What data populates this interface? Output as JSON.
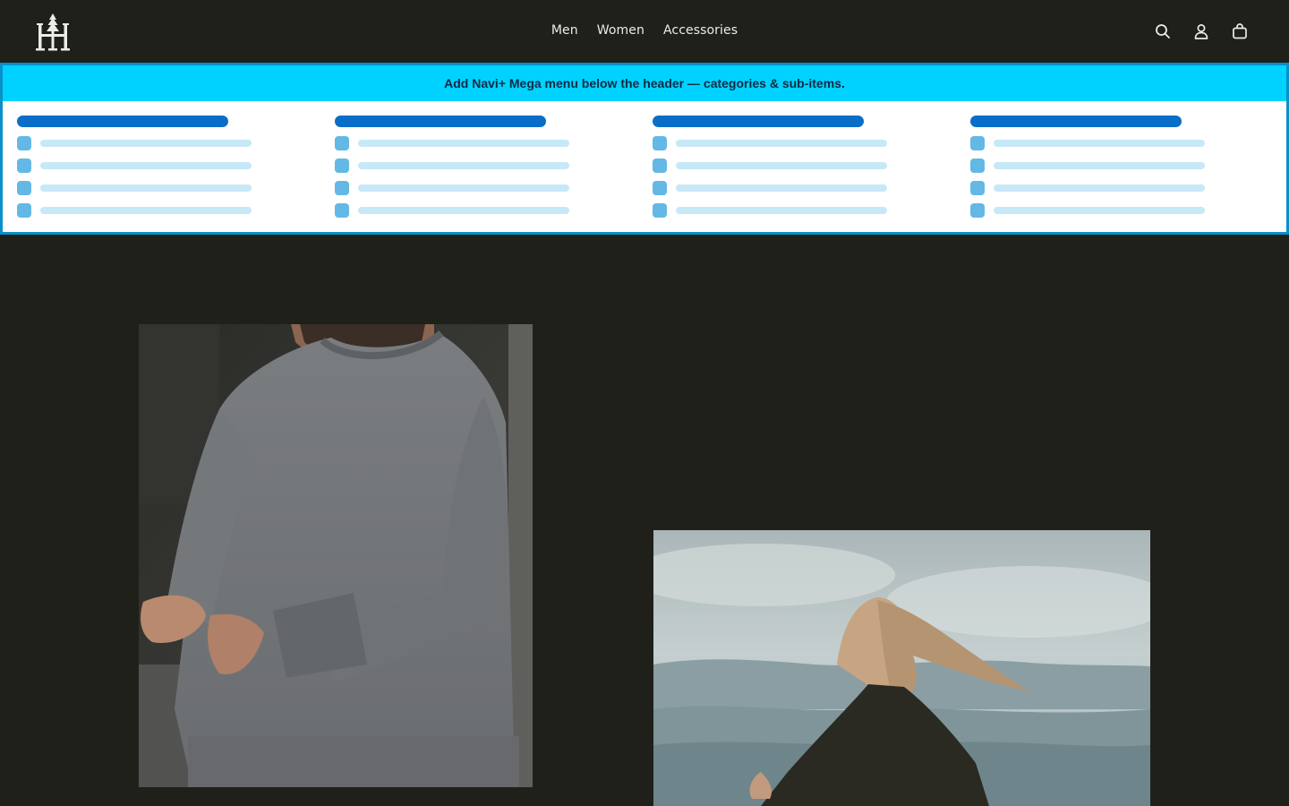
{
  "brand": {
    "logo_icon": "tree-monogram-logo",
    "logo_color": "#ecebe6"
  },
  "nav": {
    "items": [
      {
        "label": "Men"
      },
      {
        "label": "Women"
      },
      {
        "label": "Accessories"
      }
    ]
  },
  "header_icons": {
    "search": "search-icon",
    "account": "account-icon",
    "cart": "shopping-bag-icon"
  },
  "mega_menu": {
    "banner_text": "Add Navi+ Mega menu below the header — categories & sub-items.",
    "columns": 4,
    "rows_per_column": 4,
    "colors": {
      "banner": "#00d2ff",
      "border": "#0a90c8",
      "title_bar": "#0a6ec8",
      "item_square": "#63b8e6",
      "item_line": "#c7e8f7"
    }
  },
  "hero_images": [
    {
      "description_icon": "man-grey-sweater-photo"
    },
    {
      "description_icon": "woman-windblown-hair-photo"
    }
  ],
  "colors": {
    "page_background": "#20201b",
    "nav_text": "#ecebe6"
  }
}
